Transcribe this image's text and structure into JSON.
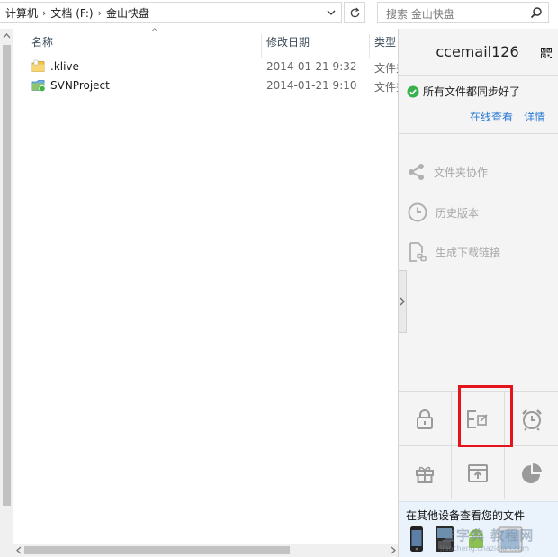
{
  "address_bar": {
    "crumbs": [
      "计算机",
      "文档 (F:)",
      "金山快盘"
    ]
  },
  "search": {
    "placeholder": "搜索 金山快盘"
  },
  "columns": {
    "name": "名称",
    "modified": "修改日期",
    "type": "类型"
  },
  "files": [
    {
      "name": ".klive",
      "modified": "2014-01-21 9:32",
      "type": "文件夹",
      "icon": "folder-icon"
    },
    {
      "name": "SVNProject",
      "modified": "2014-01-21 9:10",
      "type": "文件夹",
      "icon": "svn-folder-icon"
    }
  ],
  "panel": {
    "username": "ccemail126",
    "sync_status": "所有文件都同步好了",
    "links": {
      "online": "在线查看",
      "detail": "详情"
    },
    "actions": [
      {
        "label": "文件夹协作",
        "icon": "share-icon"
      },
      {
        "label": "历史版本",
        "icon": "clock-icon"
      },
      {
        "label": "生成下载链接",
        "icon": "link-file-icon"
      }
    ],
    "tools": [
      "lock-icon",
      "edit-document-icon",
      "alarm-clock-icon",
      "gift-icon",
      "upload-box-icon",
      "pie-chart-icon"
    ],
    "devices_title": "在其他设备查看您的文件",
    "device_icons": [
      "iphone-icon",
      "blackberry-icon",
      "android-icon",
      "ipad-icon"
    ],
    "watermark": "查字典 教程网",
    "watermark_url": "jiaocheng.chazidian.com"
  },
  "colors": {
    "link": "#2b7bd6",
    "highlight": "#e4141a",
    "sync_ok": "#37b24d"
  }
}
